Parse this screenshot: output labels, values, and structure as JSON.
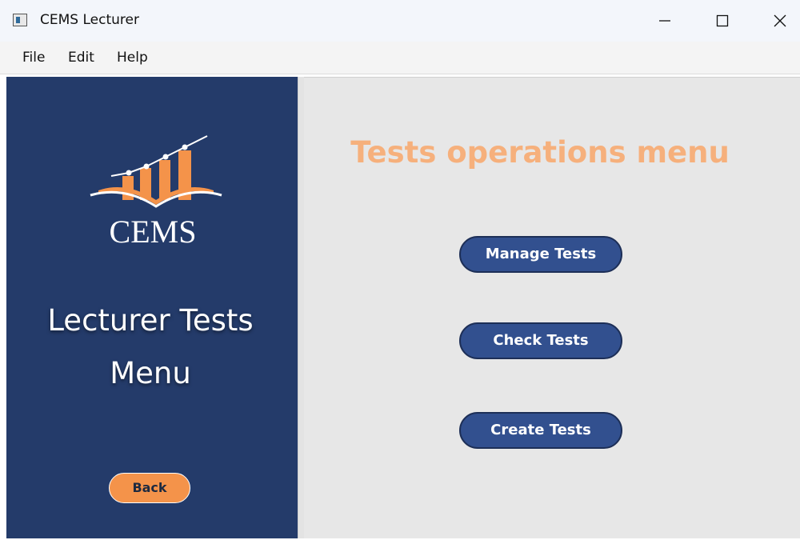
{
  "window": {
    "title": "CEMS Lecturer"
  },
  "menubar": {
    "items": [
      "File",
      "Edit",
      "Help"
    ]
  },
  "sidebar": {
    "logo_text": "CEMS",
    "heading_line1": "Lecturer Tests",
    "heading_line2": "Menu",
    "back_label": "Back"
  },
  "main": {
    "title": "Tests operations menu",
    "buttons": [
      "Manage Tests",
      "Check Tests",
      "Create Tests"
    ]
  },
  "colors": {
    "sidebar_bg": "#243b6a",
    "accent_orange": "#f4934a",
    "title_orange": "#f6b07c",
    "button_blue": "#32508f"
  }
}
